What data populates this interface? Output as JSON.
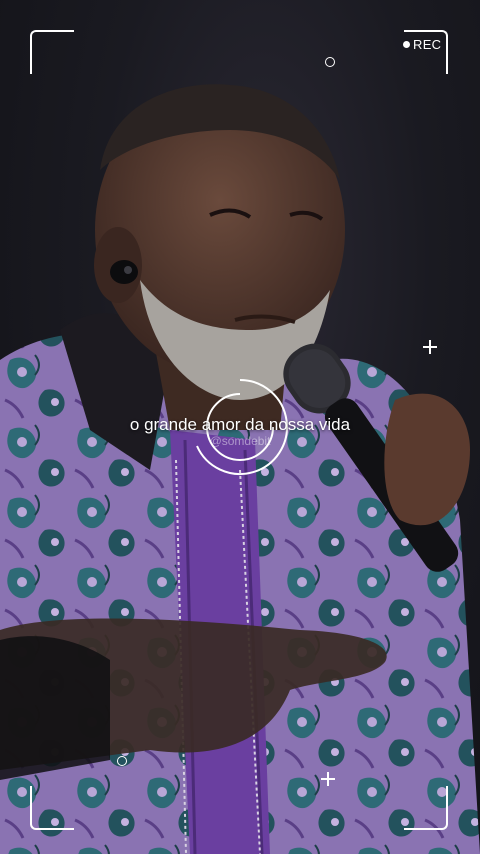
{
  "camera_overlay": {
    "rec_label": "REC",
    "icons": [
      "rec-dot-icon",
      "focus-ring-icon",
      "crosshair-plus-icon",
      "small-ring-icon"
    ]
  },
  "lyrics": {
    "current_line": "o grande amor da nossa vida"
  },
  "watermark": {
    "handle": "@somdebit"
  },
  "colors": {
    "overlay": "#ffffff",
    "background": "#16161c",
    "jacket_purple": "#8a6fb0",
    "jacket_teal": "#2f6f7a",
    "shirt_purple": "#6a3fa0"
  }
}
